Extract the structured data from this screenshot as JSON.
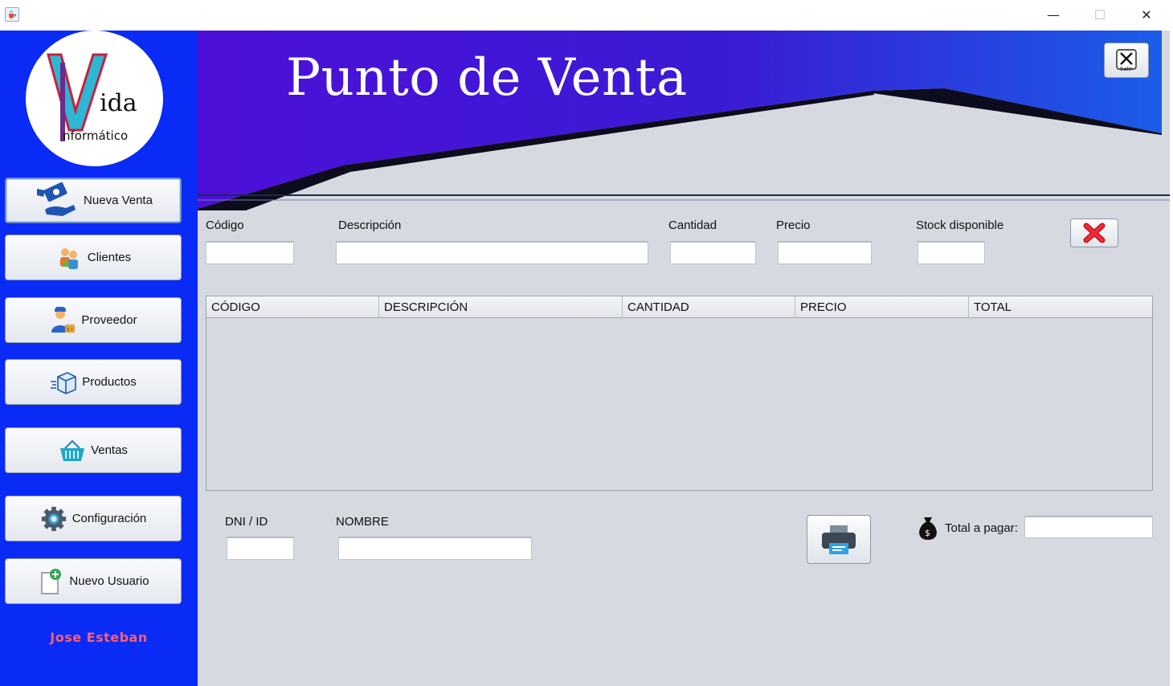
{
  "window": {
    "app_icon": "java-cup-icon",
    "controls": {
      "minimize": "—",
      "maximize": "☐",
      "close": "✕"
    }
  },
  "sidebar": {
    "logo": {
      "big_letter": "V",
      "word1": "ida",
      "word2": "nformático"
    },
    "nav": [
      {
        "id": "nueva-venta",
        "label": "Nueva Venta",
        "icon": "cash-hand-icon",
        "active": true
      },
      {
        "id": "clientes",
        "label": "Clientes",
        "icon": "clients-icon"
      },
      {
        "id": "proveedor",
        "label": "Proveedor",
        "icon": "supplier-icon"
      },
      {
        "id": "productos",
        "label": "Productos",
        "icon": "box-icon"
      },
      {
        "id": "ventas",
        "label": "Ventas",
        "icon": "basket-icon"
      },
      {
        "id": "configuracion",
        "label": "Configuración",
        "icon": "gear-icon"
      },
      {
        "id": "nuevo-usuario",
        "label": "Nuevo Usuario",
        "icon": "add-document-icon"
      }
    ],
    "user_name": "Jose Esteban"
  },
  "banner": {
    "title": "Punto de Venta",
    "exit_label": "Salir",
    "colors": {
      "purple": "#4d0fd8",
      "blue": "#1a5de8",
      "dark": "#0c0c1c"
    }
  },
  "form": {
    "codigo_label": "Código",
    "descripcion_label": "Descripción",
    "cantidad_label": "Cantidad",
    "precio_label": "Precio",
    "stock_label": "Stock disponible",
    "codigo_value": "",
    "descripcion_value": "",
    "cantidad_value": "",
    "precio_value": "",
    "stock_value": ""
  },
  "table": {
    "columns": [
      "CÓDIGO",
      "DESCRIPCIÓN",
      "CANTIDAD",
      "PRECIO",
      "TOTAL"
    ],
    "rows": []
  },
  "footer": {
    "dni_label": "DNI / ID",
    "nombre_label": "NOMBRE",
    "total_label": "Total a pagar:",
    "dni_value": "",
    "nombre_value": "",
    "total_value": ""
  }
}
